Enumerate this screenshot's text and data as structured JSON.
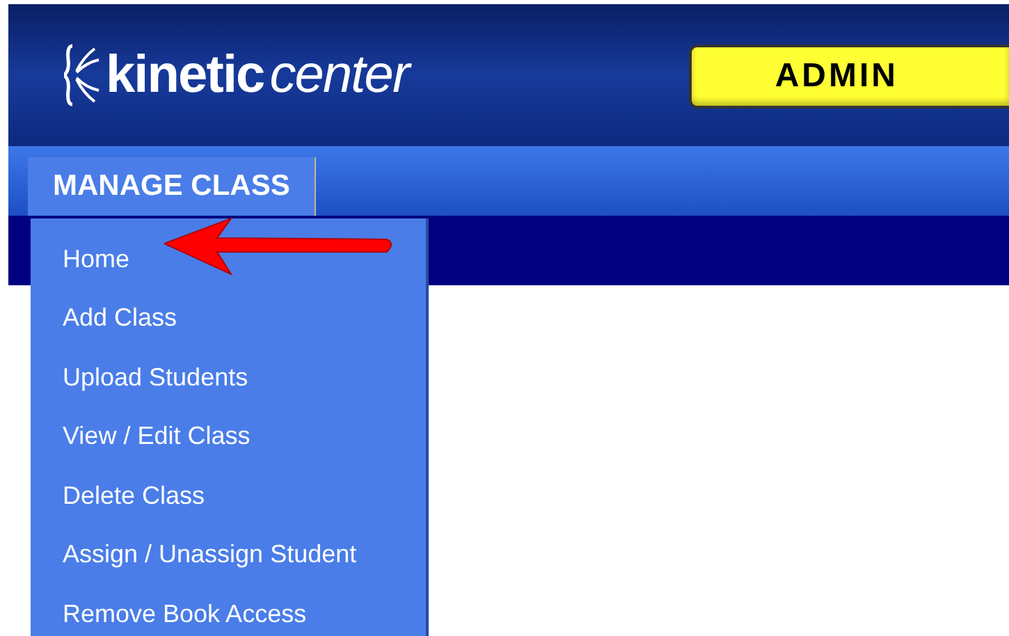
{
  "logo": {
    "bold": "kinetic",
    "light": "center"
  },
  "role_badge": "ADMIN",
  "nav_tab": {
    "label": "MANAGE CLASS",
    "expanded": true
  },
  "menu_items": [
    {
      "label": "Home",
      "pointed": true
    },
    {
      "label": "Add Class",
      "pointed": false
    },
    {
      "label": "Upload Students",
      "pointed": false
    },
    {
      "label": "View / Edit Class",
      "pointed": false
    },
    {
      "label": "Delete Class",
      "pointed": false
    },
    {
      "label": "Assign / Unassign Student",
      "pointed": false
    },
    {
      "label": "Remove Book Access",
      "pointed": false
    }
  ]
}
